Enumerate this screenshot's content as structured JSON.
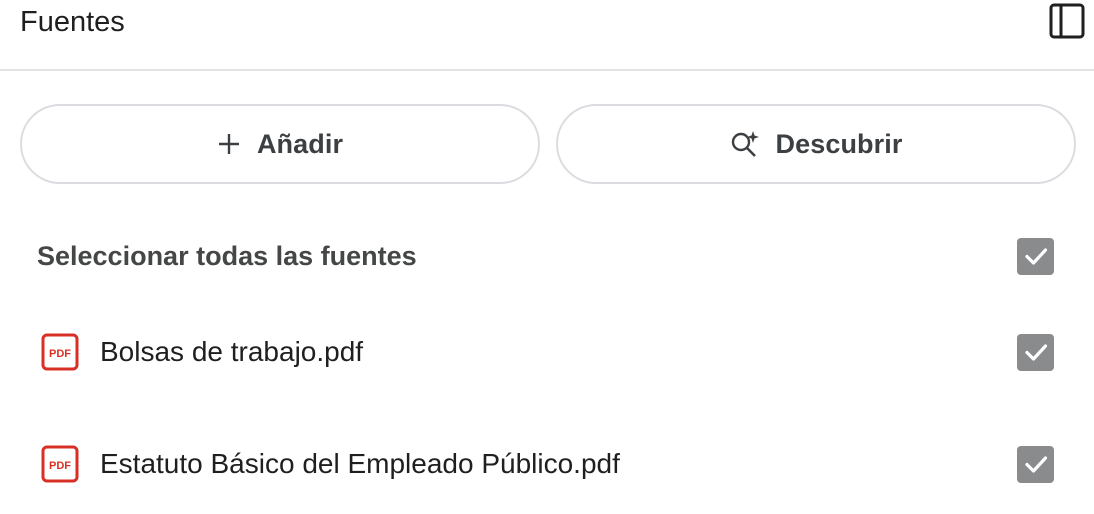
{
  "header": {
    "title": "Fuentes",
    "collapse_icon": "panel-collapse-icon"
  },
  "actions": {
    "add_label": "Añadir",
    "add_icon": "plus-icon",
    "discover_label": "Descubrir",
    "discover_icon": "search-spark-icon"
  },
  "select_all": {
    "label": "Seleccionar todas las fuentes",
    "checked": true
  },
  "sources": [
    {
      "name": "Bolsas de trabajo.pdf",
      "type_icon": "pdf-icon",
      "checked": true
    },
    {
      "name": "Estatuto Básico del Empleado Público.pdf",
      "type_icon": "pdf-icon",
      "checked": true
    }
  ],
  "colors": {
    "pdf_red": "#d93025",
    "checkbox_gray": "#8a8b8d",
    "border": "#dadce0",
    "text": "#1f1f1f"
  }
}
